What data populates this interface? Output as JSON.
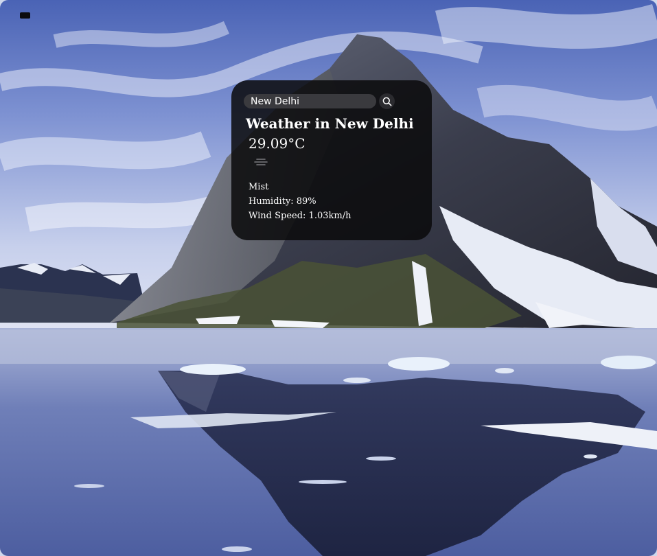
{
  "search": {
    "value": "New Delhi",
    "icon": "search-icon"
  },
  "weather": {
    "title": "Weather in New Delhi",
    "temperature": "29.09°C",
    "icon": "mist-icon",
    "description": "Mist",
    "humidity": "Humidity: 89%",
    "wind": "Wind Speed: 1.03km/h"
  },
  "menu": {
    "icon": "menu-icon"
  },
  "colors": {
    "card_bg": "#0a0a0c",
    "text": "#ffffff",
    "input_bg": "#3a3a3e"
  }
}
